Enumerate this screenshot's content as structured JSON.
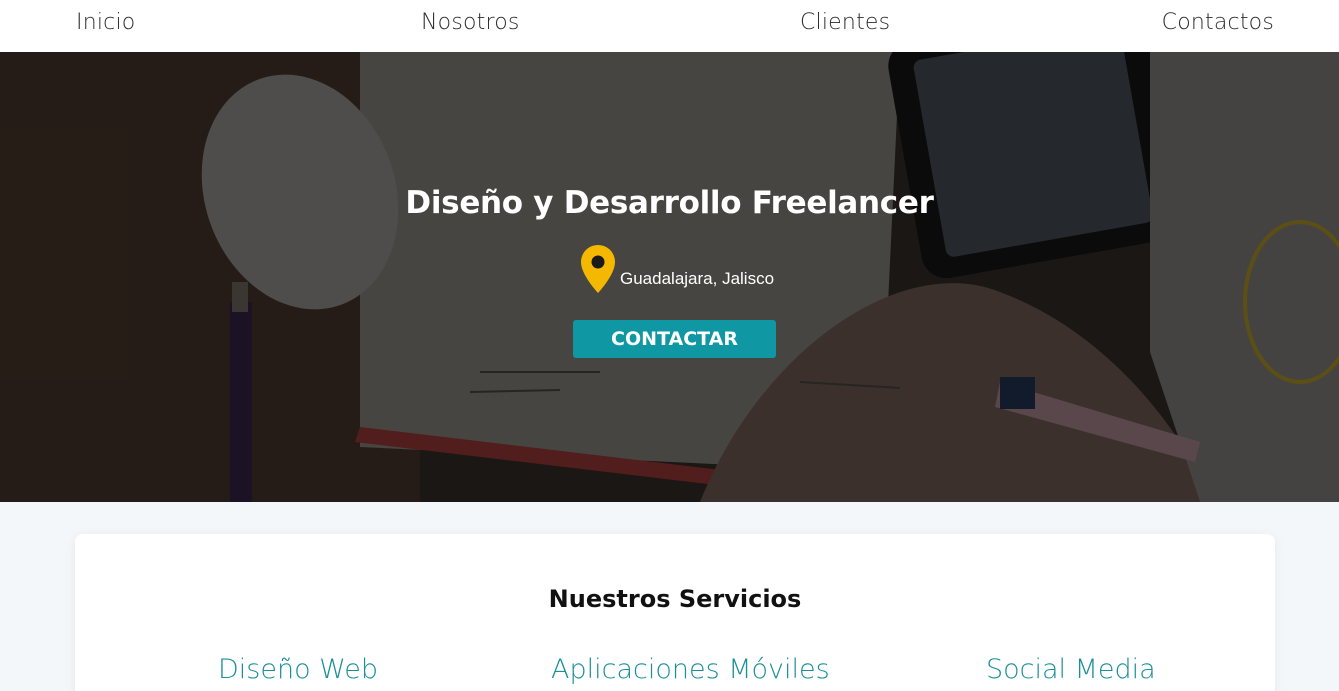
{
  "nav": {
    "inicio": "Inicio",
    "nosotros": "Nosotros",
    "clientes": "Clientes",
    "contactos": "Contactos"
  },
  "hero": {
    "title": "Diseño y Desarrollo Freelancer",
    "location": "Guadalajara, Jalisco",
    "location_icon": "map-pin-icon",
    "button_label": "CONTACTAR",
    "accent_color": "#0f97a3",
    "pin_color": "#f5b800"
  },
  "services": {
    "title": "Nuestros Servicios",
    "items": [
      "Diseño Web",
      "Aplicaciones Móviles",
      "Social Media"
    ]
  }
}
